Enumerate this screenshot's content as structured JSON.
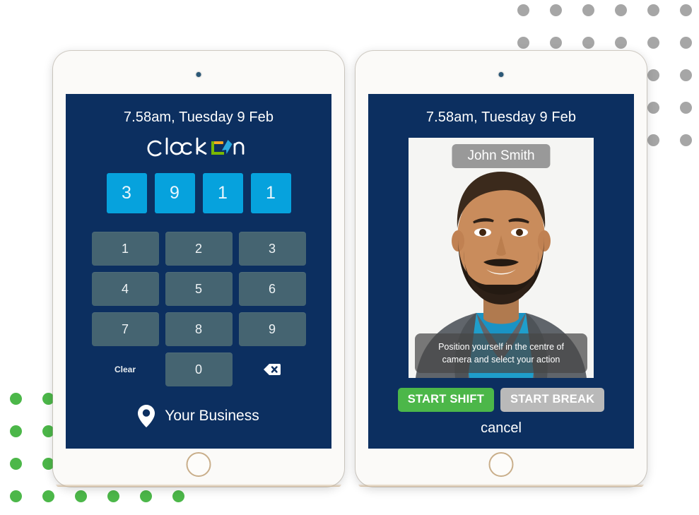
{
  "brand": {
    "logo_text": "ClockOn",
    "logo_word_part1": "Clock",
    "logo_word_part2": "n",
    "colors": {
      "screen_background": "#0c2f60",
      "pin_box": "#06a2dd",
      "keypad_button": "#456471",
      "accent_green": "#4cb749",
      "accent_gray": "#b9b9b9",
      "logo_orange": "#f5a623",
      "logo_green": "#7ab800",
      "logo_blue": "#2aa9e0",
      "dot_gray": "#a6a6a6",
      "dot_green": "#4cb749"
    }
  },
  "left_tablet": {
    "name": "pin-entry-tablet",
    "clock": "7.58am, Tuesday 9 Feb",
    "pin_digits": [
      "3",
      "9",
      "1",
      "1"
    ],
    "keypad": [
      {
        "label": "1",
        "kind": "digit"
      },
      {
        "label": "2",
        "kind": "digit"
      },
      {
        "label": "3",
        "kind": "digit"
      },
      {
        "label": "4",
        "kind": "digit"
      },
      {
        "label": "5",
        "kind": "digit"
      },
      {
        "label": "6",
        "kind": "digit"
      },
      {
        "label": "7",
        "kind": "digit"
      },
      {
        "label": "8",
        "kind": "digit"
      },
      {
        "label": "9",
        "kind": "digit"
      }
    ],
    "clear_label": "Clear",
    "zero_label": "0",
    "backspace_icon": "backspace-icon",
    "location_icon": "location-pin-icon",
    "business_name": "Your Business"
  },
  "right_tablet": {
    "name": "camera-action-tablet",
    "clock": "7.58am, Tuesday 9 Feb",
    "employee_name": "John Smith",
    "camera_hint": "Position yourself in the centre of camera and select your action",
    "start_shift_label": "START SHIFT",
    "start_break_label": "START BREAK",
    "cancel_label": "cancel"
  },
  "decor": {
    "gray_dots": {
      "icon": "dot-grid-gray",
      "columns": 6,
      "rows": 5,
      "spacing": 46,
      "diameter": 17
    },
    "green_dots": {
      "icon": "dot-grid-green",
      "columns": 6,
      "rows": 4,
      "spacing": 46,
      "diameter": 17
    }
  }
}
